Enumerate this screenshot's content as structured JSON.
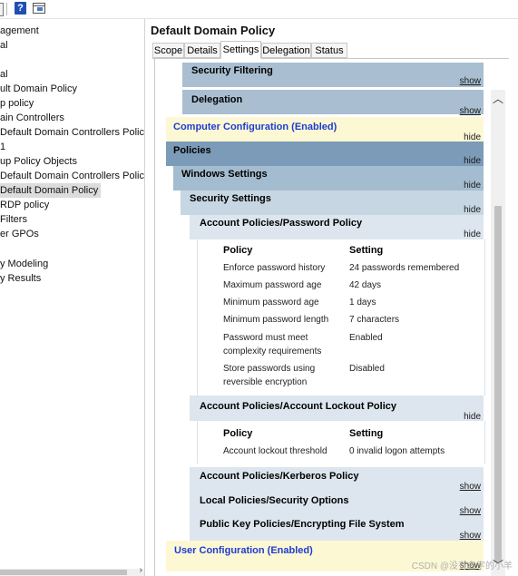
{
  "toolbar": {
    "help_icon_text": "?"
  },
  "tree": {
    "items": [
      "agement",
      "al",
      "",
      "al",
      "ult Domain Policy",
      "p policy",
      "ain Controllers",
      "Default Domain Controllers Policy",
      "1",
      "up Policy Objects",
      "Default Domain Controllers Policy",
      "Default Domain Policy",
      "RDP policy",
      " Filters",
      "er GPOs",
      "",
      "y Modeling",
      "y Results"
    ],
    "selected_index": 11
  },
  "panel": {
    "title": "Default Domain Policy",
    "tabs": [
      "Scope",
      "Details",
      "Settings",
      "Delegation",
      "Status"
    ],
    "active_tab": "Settings"
  },
  "report": {
    "sections": {
      "security_filtering": {
        "label": "Security Filtering",
        "action": "show"
      },
      "delegation": {
        "label": "Delegation",
        "action": "show"
      },
      "computer_config": {
        "label": "Computer Configuration (Enabled)",
        "action": "hide"
      },
      "policies": {
        "label": "Policies",
        "action": "hide"
      },
      "windows_settings": {
        "label": "Windows Settings",
        "action": "hide"
      },
      "security_settings": {
        "label": "Security Settings",
        "action": "hide"
      },
      "password_policy": {
        "label": "Account Policies/Password Policy",
        "action": "hide"
      },
      "lockout_policy": {
        "label": "Account Policies/Account Lockout Policy",
        "action": "hide"
      },
      "kerberos_policy": {
        "label": "Account Policies/Kerberos Policy",
        "action": "show"
      },
      "local_policies": {
        "label": "Local Policies/Security Options",
        "action": "show"
      },
      "pubkey_policies": {
        "label": "Public Key Policies/Encrypting File System",
        "action": "show"
      },
      "user_config": {
        "label": "User Configuration (Enabled)",
        "action": "show"
      }
    },
    "password_table": {
      "col_policy": "Policy",
      "col_setting": "Setting",
      "rows": [
        {
          "policy": "Enforce password history",
          "setting": "24 passwords remembered"
        },
        {
          "policy": "Maximum password age",
          "setting": "42 days"
        },
        {
          "policy": "Minimum password age",
          "setting": "1 days"
        },
        {
          "policy": "Minimum password length",
          "setting": "7 characters"
        },
        {
          "policy": "Password must meet complexity requirements",
          "setting": "Enabled"
        },
        {
          "policy": "Store passwords using reversible encryption",
          "setting": "Disabled"
        }
      ]
    },
    "lockout_table": {
      "col_policy": "Policy",
      "col_setting": "Setting",
      "rows": [
        {
          "policy": "Account lockout threshold",
          "setting": "0 invalid logon attempts"
        }
      ]
    }
  },
  "watermark": "CSDN @没有名字的小羊",
  "colors": {
    "blue_dark": "#7c9bb8",
    "blue_mid": "#a4bccf",
    "blue_light": "#c6d6e2",
    "blue_pale": "#dde6ee",
    "yellow_pale": "#fdf8d4",
    "link_blue": "#1f3bd1"
  }
}
